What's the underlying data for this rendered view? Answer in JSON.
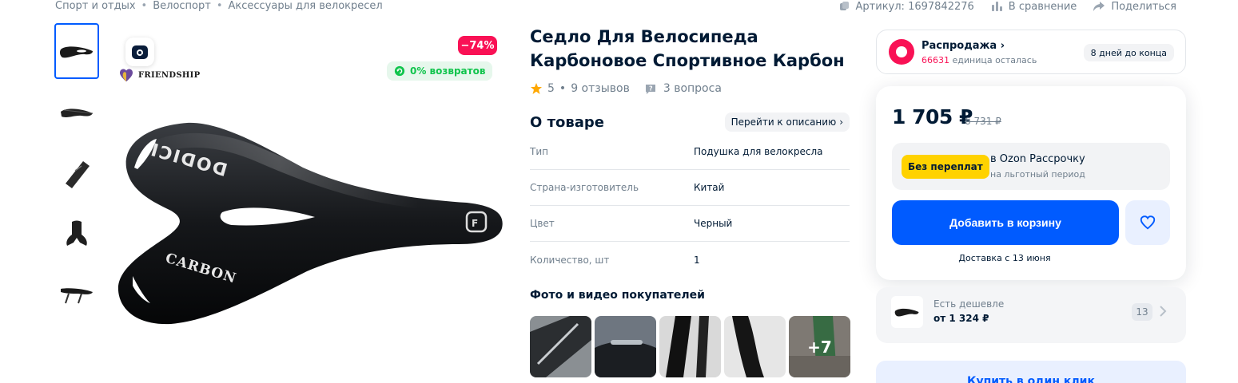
{
  "breadcrumb": [
    "Спорт и отдых",
    "Велоспорт",
    "Аксессуары для велокресел"
  ],
  "meta": {
    "article": "Артикул: 1697842276",
    "compare": "В сравнение",
    "share": "Поделиться"
  },
  "gallery": {
    "brand_name": "FRIENDSHIP",
    "discount": "−74%",
    "returns": "0% возвратов"
  },
  "product": {
    "title": "Седло Для Велосипеда Карбоновое Спортивное Карбон",
    "rating": "5",
    "reviews": "9 отзывов",
    "questions": "3 вопроса"
  },
  "about": {
    "title": "О товаре",
    "goto_label": "Перейти к описанию",
    "specs": [
      {
        "key": "Тип",
        "value": "Подушка для велокресла"
      },
      {
        "key": "Страна-изготовитель",
        "value": "Китай"
      },
      {
        "key": "Цвет",
        "value": "Черный"
      },
      {
        "key": "Количество, шт",
        "value": "1"
      }
    ]
  },
  "photos": {
    "title": "Фото и видео покупателей",
    "more": "+7"
  },
  "sale": {
    "title": "Распродажа",
    "count": "66631",
    "count_suffix": " единица осталась",
    "days": "8 дней до конца"
  },
  "price": {
    "current": "1 705 ₽",
    "old": "6 731 ₽",
    "installment_badge": "Без переплат",
    "installment_title": "в Ozon Рассрочку",
    "installment_sub": "на льготный период",
    "cart_label": "Добавить в корзину",
    "delivery": "Доставка с 13 июня"
  },
  "cheaper": {
    "label": "Есть дешевле",
    "price": "от 1 324 ₽",
    "count": "13"
  },
  "buy_one_click": "Купить в один клик",
  "colors": {
    "accent": "#005bff",
    "sale": "#f91155",
    "success": "#10c44c",
    "installment": "#ffd200"
  }
}
